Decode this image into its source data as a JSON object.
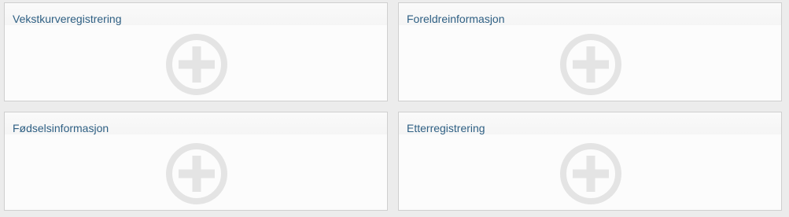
{
  "cards": [
    {
      "title": "Vekstkurveregistrering",
      "icon": "add-circle-icon"
    },
    {
      "title": "Foreldreinformasjon",
      "icon": "add-circle-icon"
    },
    {
      "title": "Fødselsinformasjon",
      "icon": "add-circle-icon"
    },
    {
      "title": "Etterregistrering",
      "icon": "add-circle-icon"
    }
  ],
  "colors": {
    "title": "#2e5f83",
    "icon": "#e4e4e4",
    "card_bg": "#fcfcfc",
    "card_border": "#cfcfcf",
    "page_bg": "#ececec"
  }
}
